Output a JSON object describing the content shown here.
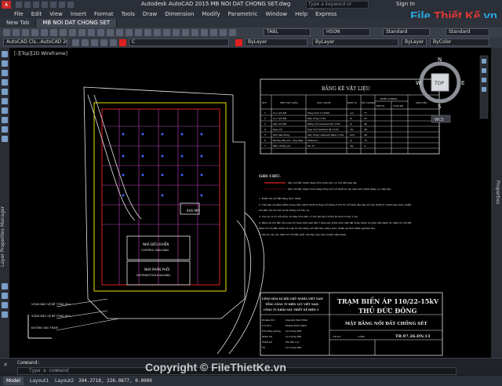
{
  "app": {
    "title": "Autodesk AutoCAD 2015    MB NOI DAT CHONG SET.dwg",
    "search_placeholder": "Type a keyword or phrase",
    "sign_in": "Sign In",
    "app_button": "A"
  },
  "menu": [
    "File",
    "Edit",
    "View",
    "Insert",
    "Format",
    "Tools",
    "Draw",
    "Dimension",
    "Modify",
    "Parametric",
    "Window",
    "Help",
    "Express"
  ],
  "logo": {
    "part1": "File",
    "part2": "Thiết Kế",
    "part3": ".vn"
  },
  "tabs": [
    {
      "label": "New Tab",
      "active": false
    },
    {
      "label": "MB NOI DAT CHONG SET",
      "active": true
    }
  ],
  "ribbon": {
    "row1": {
      "tabl": "TABL",
      "hson": "HSON",
      "standard1": "Standard",
      "standard2": "Standard"
    },
    "row2": {
      "workspace": "AutoCAD Cls...AutoCAD 201",
      "layer": "C",
      "bylayer1": "ByLayer",
      "bylayer2": "ByLayer",
      "bylayer3": "ByLayer",
      "bycolor": "ByColor"
    }
  },
  "side_labels": {
    "left": "Layer Properties Manager",
    "right": "Properties"
  },
  "viewport": {
    "label": "[-][Top][2D Wireframe]"
  },
  "viewcube": {
    "top": "TOP",
    "n": "N",
    "s": "S",
    "e": "E",
    "w": "W",
    "wcs": "WCS"
  },
  "drawing": {
    "table_title": "BẢNG KÊ VẬT LIỆU",
    "table_headers": [
      "STT",
      "TÊN VẬT LIỆU",
      "QUY CÁCH",
      "ĐƠN VỊ",
      "SỐ LƯỢNG",
      "KHỐI LƯỢNG",
      "GHI CHÚ"
    ],
    "table_subheaders": [
      "ĐƠN VỊ",
      "TOÀN BỘ"
    ],
    "table_rows": [
      [
        "1",
        "Cọc nối đất",
        "Thép tròn L=2500",
        "cọc",
        "77",
        "",
        ""
      ],
      [
        "2",
        "Cọc nối đất",
        "Dây đồng C120",
        "m",
        "87",
        "",
        ""
      ],
      [
        "3",
        "Dây nối đất",
        "Bảng nối Cadweld đề C120",
        "m",
        "40",
        "",
        ""
      ],
      [
        "4",
        "Kẹp nối",
        "Kẹp nối Cadweld đề C120",
        "cái",
        "40",
        "",
        ""
      ],
      [
        "5",
        "Mối hàn đồng",
        "Dây đồng Cadweld bằng C120",
        "mối",
        "40",
        "",
        ""
      ],
      [
        "6",
        "Đường dây nối - ống thép",
        "Ø34x4.0",
        "m",
        "75",
        "",
        ""
      ],
      [
        "7",
        "Đấu chống sét",
        "DL.75",
        "cái",
        "4",
        "",
        ""
      ]
    ],
    "notes_title": "GHI CHÚ:",
    "legend": [
      "Dây nối đất chính (thép tròn Ø14) 2m cọc nối đất tiếp địa",
      "Dây nối đất (thép tròn) bằng đồng nối với thiết bị vào nhà lưới chính bằng cọc tiếp địa"
    ],
    "notes": [
      "1. Kiểm tra nối đất bằng thực hành.",
      "2. Tiếp địa và bằng điểm trung tâm chính thiết bị thép nối đồng C120 đồ nối hiệu đặt dây nối vào thiết bị chính theo tiêu chuẩn.",
      "   nối đất của tòa nối và hệ thống nối bảo vệ.",
      "3. Tại các vị trí nối đồng và thép tròn đều có lớp vật liệu chống ăn mòn trong 2 lớp.",
      "4. Bảng vẽ nối đất của toàn bộ trạm dưới mặt đất ở tầng sâu 0,8m dưới mặt đất hoàn thiện và phải tiến hành đo điện trở nối đất.",
      "   điện trở nối đất chính và toàn bộ hệ thống nối đất theo đúng tiêu chuẩn tại thời điểm nghiệm thu.",
      "5. Giá trị của các điện trở nối đất phải vừa đáp ứng tiêu chuẩn hiện hành."
    ],
    "labels": {
      "khu_ma": "KHU MA",
      "control_bldg_vn": "NHÀ ĐIỀU KHIỂN",
      "control_bldg_en": "CONTROL BUILDING",
      "dist_bldg_vn": "NHÀ PHÂN PHỐI",
      "dist_bldg_en": "DISTRIBUTION BUILDING",
      "fence1": "VÒNG BẢO VỆ BÊ TÔNG Ø14",
      "fence2": "VÒNG BẢO VỆ BÊ TÔNG Ø14",
      "road": "ĐƯỜNG VÀO TRẠM"
    },
    "titleblock": {
      "org1": "CỘNG HÒA XÃ HỘI CHỦ NGHĨA VIỆT NAM",
      "org2": "TỔNG CÔNG TY ĐIỆN LỰC VIỆT NAM",
      "org3": "CÔNG TY KHẢO SÁT THIẾT KẾ ĐIỆN 3",
      "project": "TRẠM BIẾN ÁP 110/22-15kV",
      "location": "THỦ ĐỨC ĐÔNG",
      "drawing_title": "MẶT BẰNG NỐI ĐẤT CHỐNG SÉT",
      "drawing_no": "TR.97.26.DN.13",
      "roles": [
        "P.Giám đốc",
        "C.N.Đ.A",
        "P.Trưởng phòng",
        "Kiểm tra",
        "Thiết kế",
        "Vẽ"
      ],
      "names": [
        "Nguyễn Văn Trình",
        "Huỳnh Kiến Hạnh",
        "Lê Trung Hải",
        "Lê Trung Hải",
        "Hà Văn Lực",
        "Lê Trung Hải"
      ],
      "scale_label": "T.K.K.T",
      "scale": "1/300"
    }
  },
  "command": {
    "history": "Command:",
    "placeholder": "Type a command"
  },
  "status": {
    "tabs": [
      "Model",
      "Layout1",
      "Layout2"
    ],
    "coords": "394.2718, 226.0877, 0.0000",
    "watermark": "Copyright © FileThietKe.vn"
  },
  "colors": {
    "canvas": "#000000",
    "boundary_red": "#e02020",
    "fence_yellow": "#e8e000",
    "grid_magenta": "#c040c0",
    "blue_marks": "#4060ff",
    "white_lines": "#e8e8e8"
  }
}
